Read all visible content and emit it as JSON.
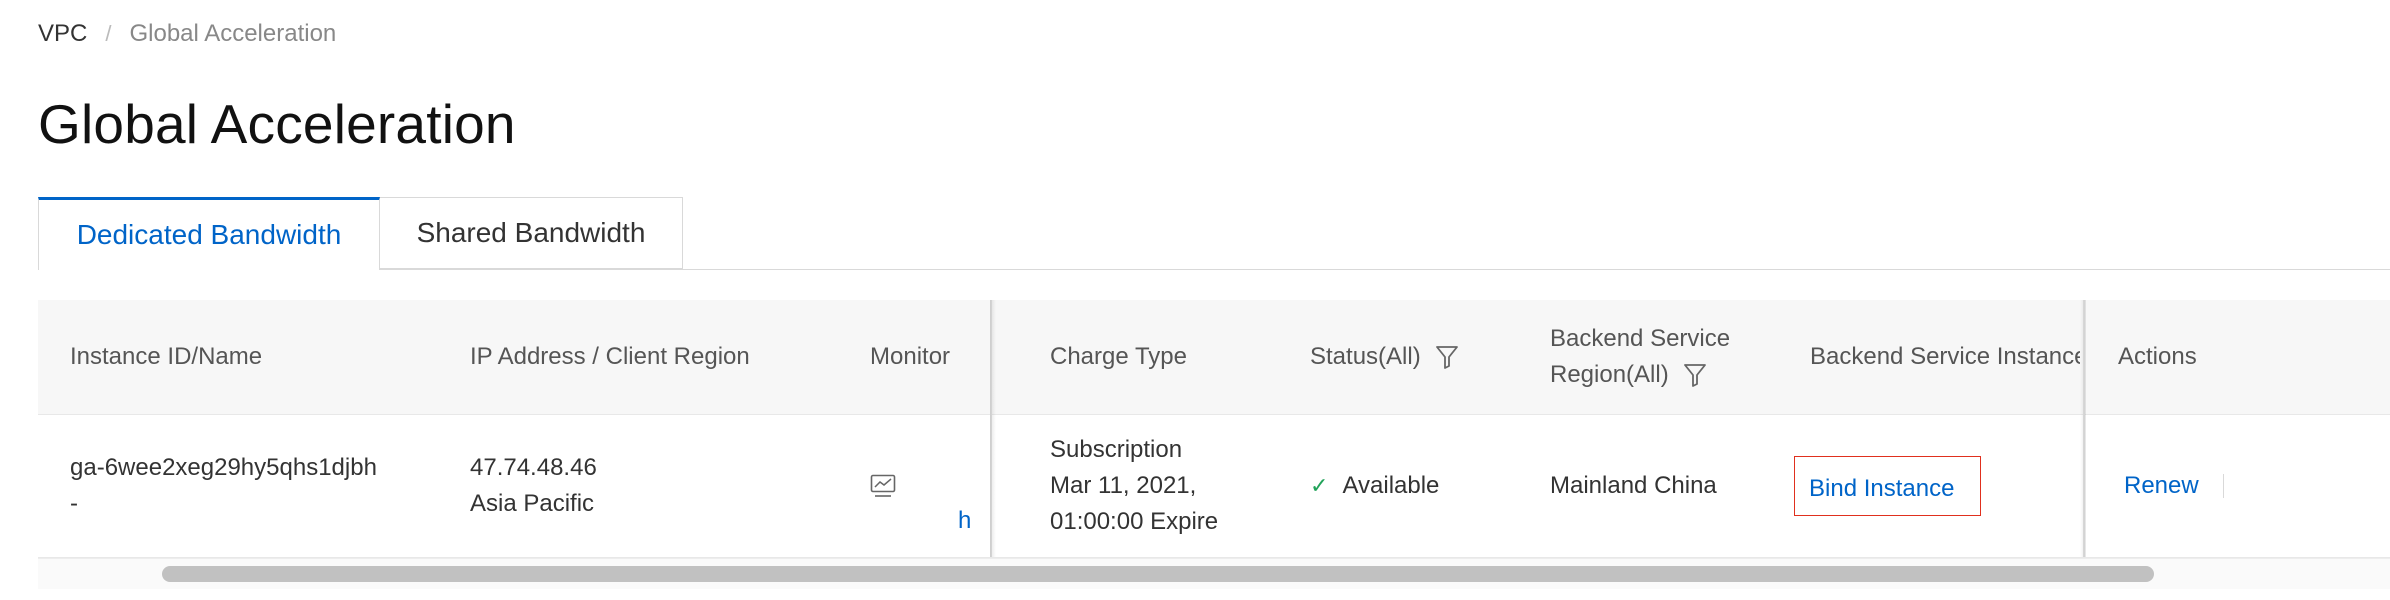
{
  "breadcrumb": {
    "root": "VPC",
    "separator": "/",
    "current": "Global Acceleration"
  },
  "page_title": "Global Acceleration",
  "tabs": [
    {
      "label": "Dedicated Bandwidth",
      "active": true
    },
    {
      "label": "Shared Bandwidth",
      "active": false
    }
  ],
  "table": {
    "columns": {
      "instance": "Instance ID/Name",
      "ip": "IP Address / Client Region",
      "monitor": "Monitor",
      "charge": "Charge Type",
      "status": "Status(All)",
      "region_line1": "Backend Service",
      "region_line2": "Region(All)",
      "backend_instance": "Backend Service Instance",
      "actions": "Actions"
    },
    "rows": [
      {
        "instance_id": "ga-6wee2xeg29hy5qhs1djbh",
        "instance_name": "-",
        "ip": "47.74.48.46",
        "client_region": "Asia Pacific",
        "monitor_link": "h",
        "charge_line1": "Subscription",
        "charge_line2": "Mar 11, 2021,",
        "charge_line3": "01:00:00 Expire",
        "status": "Available",
        "region": "Mainland China",
        "bind_label": "Bind Instance",
        "renew_label": "Renew"
      }
    ]
  },
  "icons": {
    "status": "check-icon",
    "filter": "filter-icon",
    "monitor": "monitor-chart-icon"
  },
  "colors": {
    "link": "#0064c8",
    "success": "#22a35a",
    "highlight": "#e0301e"
  }
}
